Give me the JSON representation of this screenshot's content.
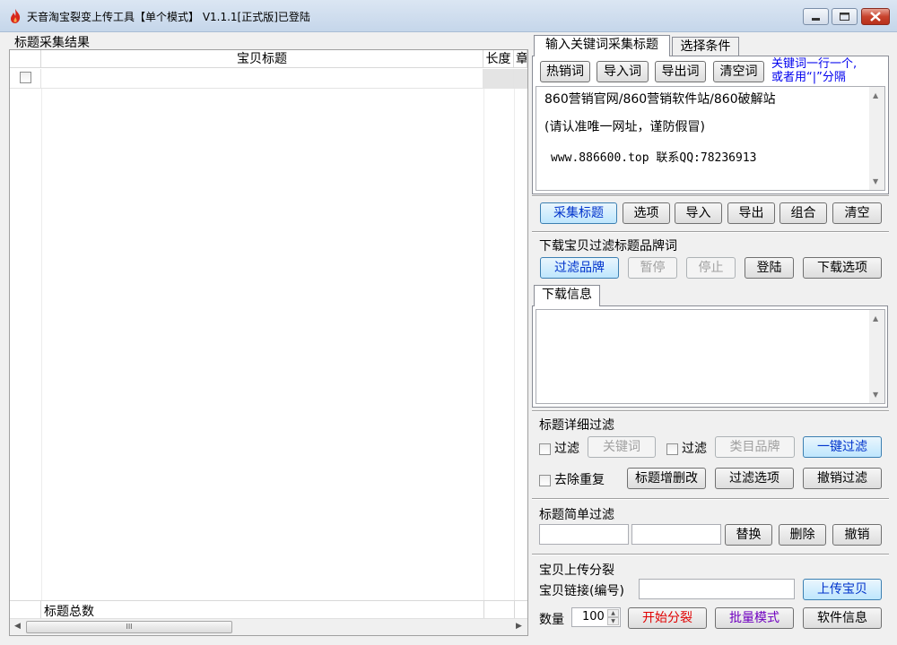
{
  "window": {
    "title": "天音淘宝裂变上传工具【单个模式】 V1.1.1[正式版]已登陆"
  },
  "left": {
    "results_label": "标题采集结果",
    "columns": [
      "宝贝标题",
      "长度",
      "章"
    ],
    "footer_label": "标题总数",
    "scroll_thumb": "III"
  },
  "tabs": {
    "keyword_tab": "输入关键词采集标题",
    "filter_tab": "选择条件"
  },
  "keyword": {
    "hot_button": "热销词",
    "import_button": "导入词",
    "export_button": "导出词",
    "clear_button": "清空词",
    "hint_line1": "关键词一行一个,",
    "hint_line2": "或者用“|”分隔",
    "text_line1": "860营销官网/860营销软件站/860破解站",
    "text_line2": "(请认准唯一网址，谨防假冒)",
    "text_line3": "www.886600.top  联系QQ:78236913"
  },
  "actions": {
    "collect": "采集标题",
    "options": "选项",
    "import": "导入",
    "export": "导出",
    "combine": "组合",
    "clear": "清空"
  },
  "download": {
    "section_label": "下载宝贝过滤标题品牌词",
    "filter_brand": "过滤品牌",
    "pause": "暂停",
    "stop": "停止",
    "login": "登陆",
    "download_options": "下载选项",
    "info_tab": "下载信息"
  },
  "detail_filter": {
    "section_label": "标题详细过滤",
    "filter1_label": "过滤",
    "keyword_button": "关键词",
    "filter2_label": "过滤",
    "category_brand_button": "类目品牌",
    "one_click_button": "一键过滤",
    "dedupe_label": "去除重复",
    "edit_button": "标题增删改",
    "filter_options_button": "过滤选项",
    "undo_button": "撤销过滤"
  },
  "simple_filter": {
    "section_label": "标题简单过滤",
    "replace_button": "替换",
    "delete_button": "删除",
    "undo_button": "撤销"
  },
  "upload": {
    "section_label": "宝贝上传分裂",
    "link_label": "宝贝链接(编号)",
    "upload_button": "上传宝贝",
    "qty_label": "数量",
    "qty_value": "100",
    "start_button": "开始分裂",
    "batch_button": "批量模式",
    "info_button": "软件信息"
  }
}
